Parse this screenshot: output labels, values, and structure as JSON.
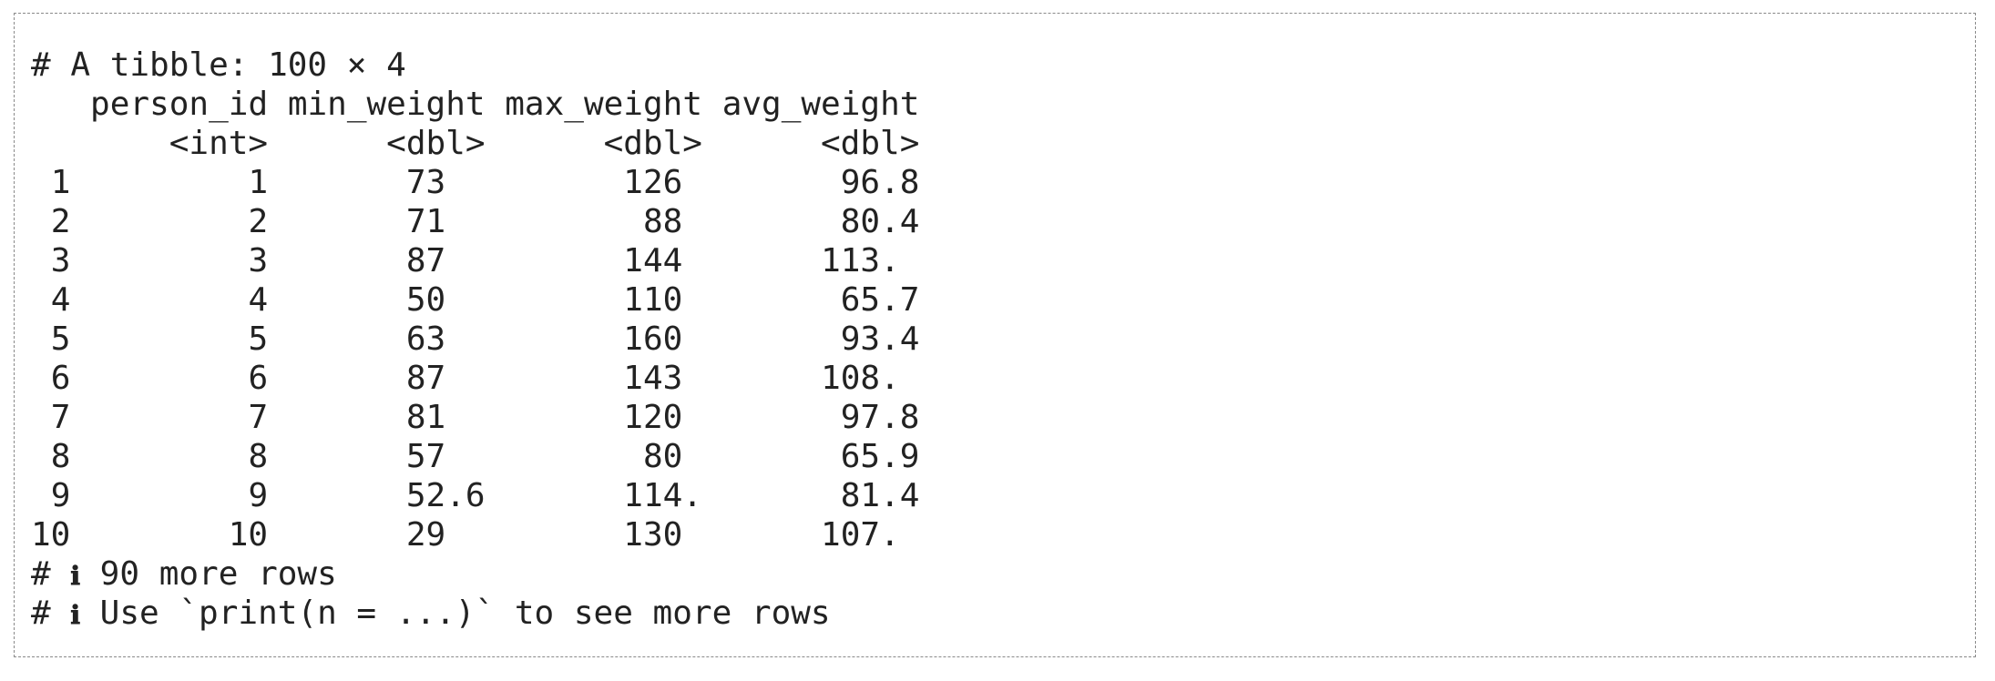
{
  "tibble": {
    "header": "# A tibble: 100 × 4",
    "columns": [
      {
        "name": "person_id",
        "type": "<int>"
      },
      {
        "name": "min_weight",
        "type": "<dbl>"
      },
      {
        "name": "max_weight",
        "type": "<dbl>"
      },
      {
        "name": "avg_weight",
        "type": "<dbl>"
      }
    ],
    "rows": [
      {
        "index": "1",
        "person_id": "1",
        "min_weight": "73",
        "max_weight": "126",
        "avg_weight": "96.8"
      },
      {
        "index": "2",
        "person_id": "2",
        "min_weight": "71",
        "max_weight": "88",
        "avg_weight": "80.4"
      },
      {
        "index": "3",
        "person_id": "3",
        "min_weight": "87",
        "max_weight": "144",
        "avg_weight": "113."
      },
      {
        "index": "4",
        "person_id": "4",
        "min_weight": "50",
        "max_weight": "110",
        "avg_weight": "65.7"
      },
      {
        "index": "5",
        "person_id": "5",
        "min_weight": "63",
        "max_weight": "160",
        "avg_weight": "93.4"
      },
      {
        "index": "6",
        "person_id": "6",
        "min_weight": "87",
        "max_weight": "143",
        "avg_weight": "108."
      },
      {
        "index": "7",
        "person_id": "7",
        "min_weight": "81",
        "max_weight": "120",
        "avg_weight": "97.8"
      },
      {
        "index": "8",
        "person_id": "8",
        "min_weight": "57",
        "max_weight": "80",
        "avg_weight": "65.9"
      },
      {
        "index": "9",
        "person_id": "9",
        "min_weight": "52.6",
        "max_weight": "114.",
        "avg_weight": "81.4"
      },
      {
        "index": "10",
        "person_id": "10",
        "min_weight": "29",
        "max_weight": "130",
        "avg_weight": "107."
      }
    ],
    "footer": [
      {
        "prefix": "# ",
        "icon": "ℹ",
        "text": " 90 more rows"
      },
      {
        "prefix": "# ",
        "icon": "ℹ",
        "text": " Use `print(n = ...)` to see more rows"
      }
    ]
  }
}
